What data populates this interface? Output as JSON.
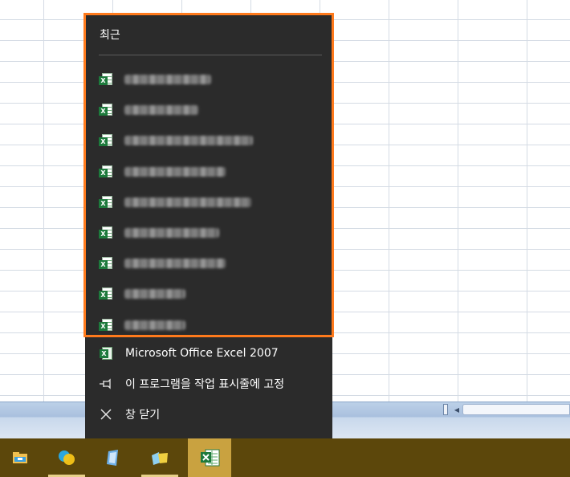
{
  "recent": {
    "header": "최근",
    "items": [
      {
        "icon": "excel-file-icon",
        "width": 108
      },
      {
        "icon": "excel-file-icon",
        "width": 92
      },
      {
        "icon": "excel-file-icon",
        "width": 160
      },
      {
        "icon": "excel-file-icon",
        "width": 126
      },
      {
        "icon": "excel-file-icon",
        "width": 158
      },
      {
        "icon": "excel-file-icon",
        "width": 118
      },
      {
        "icon": "excel-file-icon",
        "width": 126
      },
      {
        "icon": "excel-file-icon",
        "width": 76
      },
      {
        "icon": "excel-file-icon",
        "width": 76
      }
    ]
  },
  "tasks": {
    "app_label": "Microsoft Office Excel 2007",
    "pin_label": "이 프로그램을 작업 표시줄에 고정",
    "close_label": "창 닫기"
  },
  "taskbar": {
    "buttons": [
      {
        "name": "file-explorer-icon",
        "active": false
      },
      {
        "name": "app-circles-icon",
        "active": false
      },
      {
        "name": "app-blue-doc-icon",
        "active": false
      },
      {
        "name": "app-folders-icon",
        "active": false
      },
      {
        "name": "excel-icon",
        "active": true
      }
    ]
  },
  "colors": {
    "highlight_border": "#ff7a1c",
    "jumplist_bg": "#2b2b2b",
    "taskbar_bg": "#5c470b",
    "active_button": "#c9a240"
  }
}
